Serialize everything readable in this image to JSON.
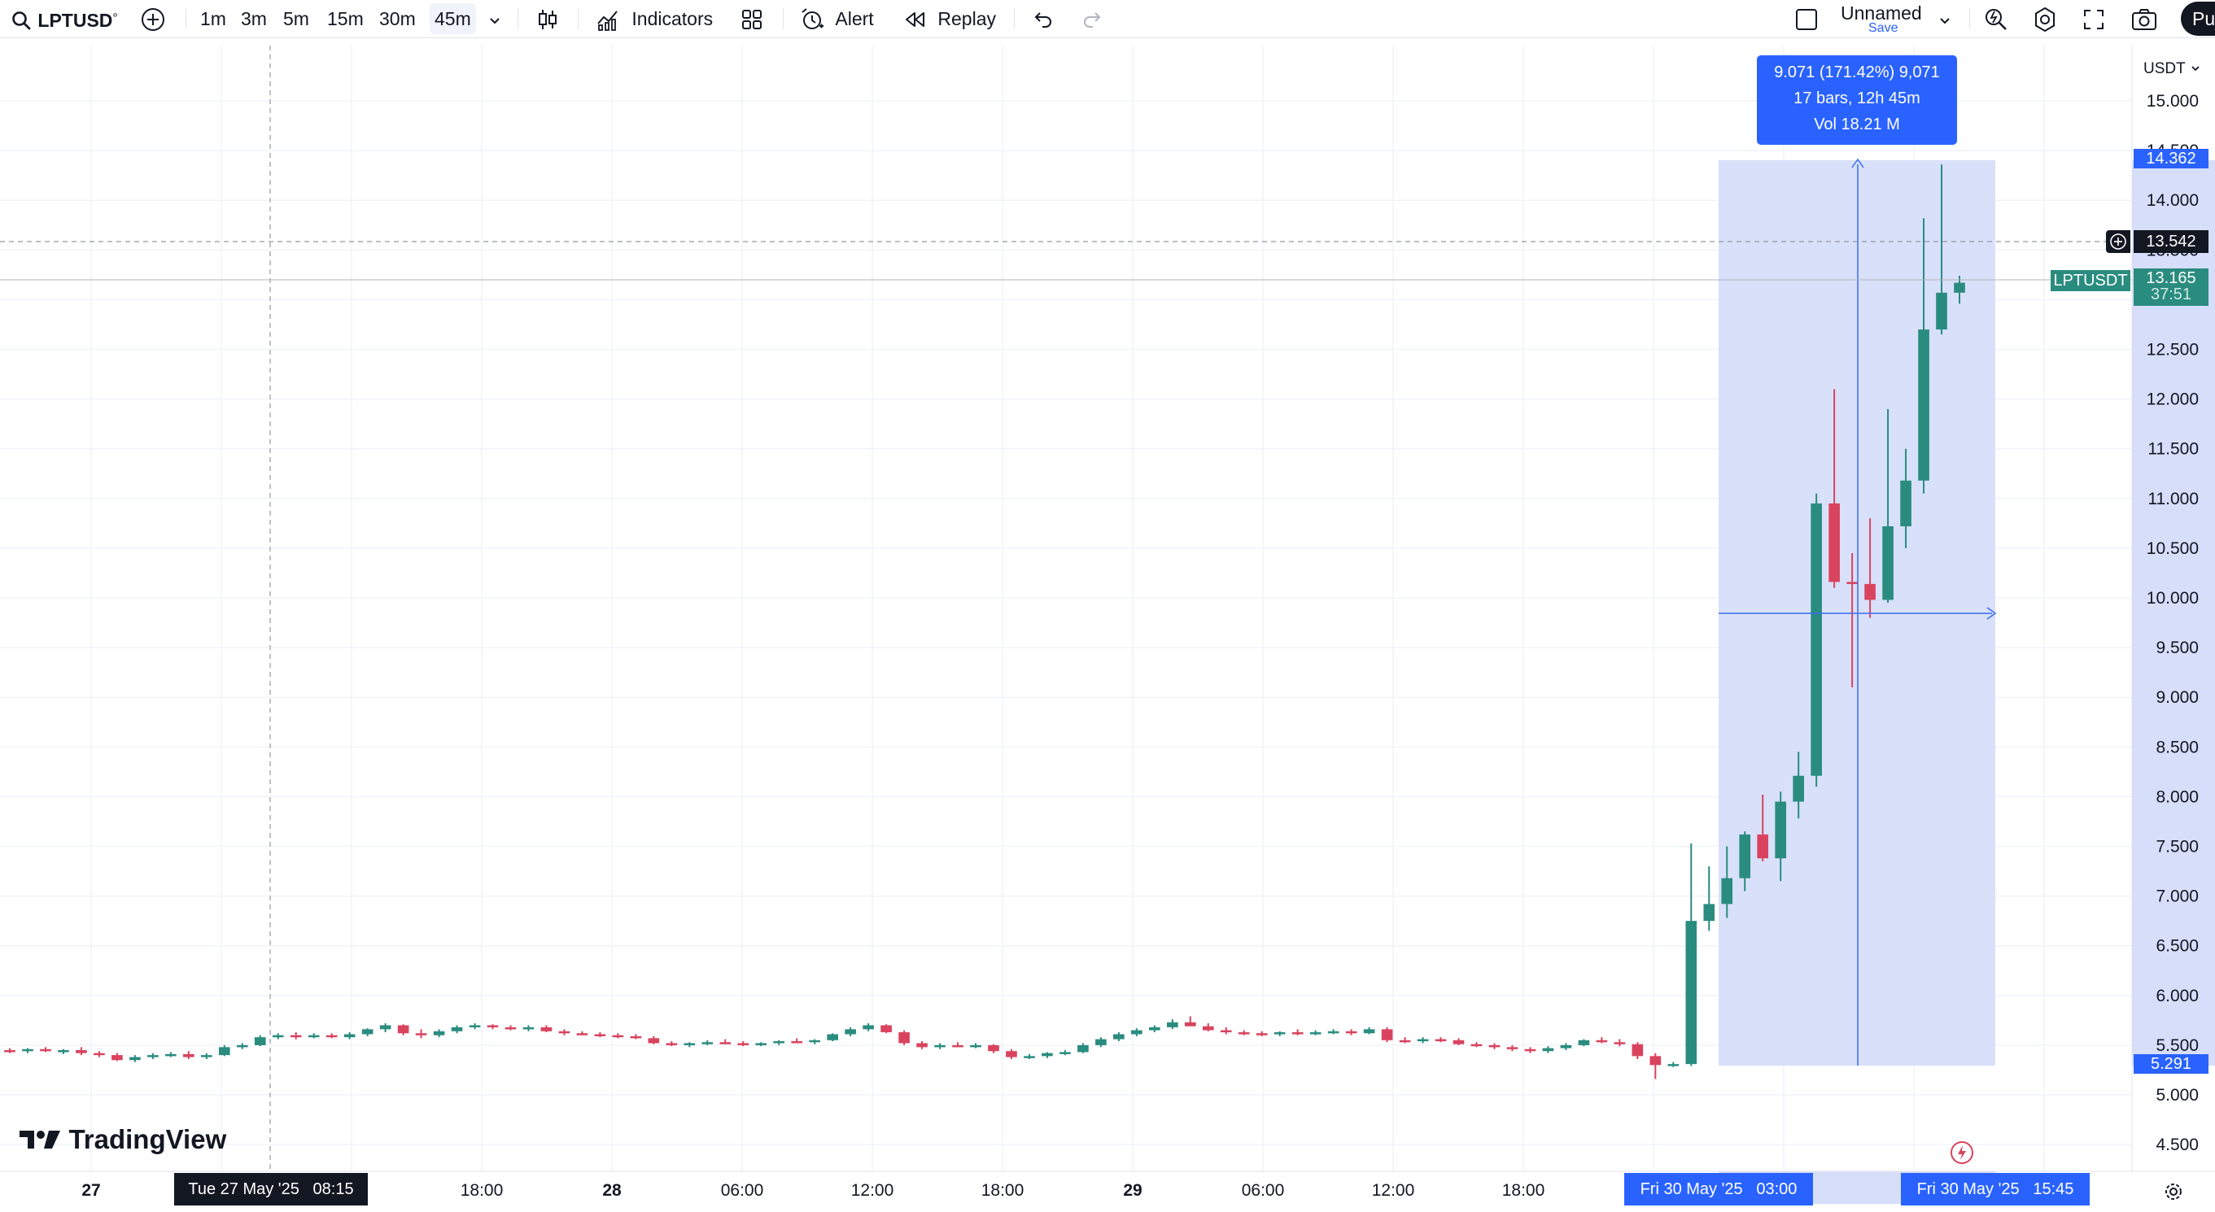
{
  "toolbar": {
    "symbol": "LPTUSD",
    "symbol_mark": "°",
    "timeframes": [
      "1m",
      "3m",
      "5m",
      "15m",
      "30m",
      "45m"
    ],
    "active_timeframe": "45m",
    "indicators_label": "Indicators",
    "alert_label": "Alert",
    "replay_label": "Replay",
    "layout_name": "Unnamed",
    "layout_save": "Save",
    "publish_label": "Pu"
  },
  "chart": {
    "currency_label": "USDT",
    "watermark": "TradingView",
    "colors": {
      "up": "#2a8c7f",
      "down": "#d9435e",
      "accent": "#2962ff",
      "range_fill": "#d6defa"
    },
    "price_ticks": [
      "15.000",
      "14.500",
      "14.000",
      "13.500",
      "13.000",
      "12.500",
      "12.000",
      "11.500",
      "11.000",
      "10.500",
      "10.000",
      "9.500",
      "9.000",
      "8.500",
      "8.000",
      "7.500",
      "7.000",
      "6.500",
      "6.000",
      "5.500",
      "5.000",
      "4.500"
    ],
    "time_ticks": [
      "27",
      "18:00",
      "28",
      "06:00",
      "12:00",
      "18:00",
      "29",
      "06:00",
      "12:00",
      "18:00"
    ],
    "measure": {
      "line1": "9.071 (171.42%) 9,071",
      "line2": "17 bars, 12h 45m",
      "line3": "Vol 18.21 M"
    },
    "price_labels": {
      "measure_high": "14.362",
      "crosshair": "13.542",
      "last": "13.165",
      "countdown": "37:51",
      "measure_low": "5.291",
      "symbol_tag": "LPTUSDT"
    },
    "time_labels": {
      "crosshair": "Tue 27 May '25   08:15",
      "range_start": "Fri 30 May '25   03:00",
      "range_end": "Fri 30 May '25   15:45"
    }
  },
  "chart_data": {
    "type": "candlestick",
    "symbol": "LPTUSD",
    "interval": "45m",
    "currency": "USDT",
    "x_ticks": [
      "27",
      "18:00",
      "28",
      "06:00",
      "12:00",
      "18:00",
      "29",
      "06:00",
      "12:00",
      "18:00"
    ],
    "ylim": [
      4.3,
      15.1
    ],
    "candles": [
      [
        5.45,
        5.47,
        5.42,
        5.44
      ],
      [
        5.44,
        5.47,
        5.42,
        5.46
      ],
      [
        5.46,
        5.48,
        5.43,
        5.44
      ],
      [
        5.44,
        5.46,
        5.41,
        5.45
      ],
      [
        5.45,
        5.48,
        5.4,
        5.42
      ],
      [
        5.42,
        5.44,
        5.38,
        5.4
      ],
      [
        5.4,
        5.42,
        5.34,
        5.35
      ],
      [
        5.35,
        5.4,
        5.33,
        5.38
      ],
      [
        5.38,
        5.42,
        5.36,
        5.4
      ],
      [
        5.4,
        5.43,
        5.38,
        5.41
      ],
      [
        5.41,
        5.44,
        5.36,
        5.38
      ],
      [
        5.38,
        5.42,
        5.36,
        5.4
      ],
      [
        5.4,
        5.5,
        5.39,
        5.48
      ],
      [
        5.48,
        5.52,
        5.46,
        5.5
      ],
      [
        5.5,
        5.6,
        5.49,
        5.58
      ],
      [
        5.58,
        5.62,
        5.56,
        5.6
      ],
      [
        5.6,
        5.63,
        5.56,
        5.59
      ],
      [
        5.59,
        5.62,
        5.57,
        5.6
      ],
      [
        5.6,
        5.62,
        5.57,
        5.58
      ],
      [
        5.58,
        5.63,
        5.56,
        5.61
      ],
      [
        5.61,
        5.67,
        5.59,
        5.66
      ],
      [
        5.66,
        5.72,
        5.63,
        5.7
      ],
      [
        5.7,
        5.71,
        5.6,
        5.62
      ],
      [
        5.62,
        5.66,
        5.57,
        5.6
      ],
      [
        5.6,
        5.66,
        5.58,
        5.64
      ],
      [
        5.64,
        5.7,
        5.62,
        5.68
      ],
      [
        5.68,
        5.72,
        5.66,
        5.7
      ],
      [
        5.7,
        5.71,
        5.66,
        5.68
      ],
      [
        5.68,
        5.7,
        5.65,
        5.67
      ],
      [
        5.67,
        5.7,
        5.64,
        5.68
      ],
      [
        5.68,
        5.7,
        5.63,
        5.64
      ],
      [
        5.64,
        5.66,
        5.6,
        5.62
      ],
      [
        5.62,
        5.64,
        5.6,
        5.61
      ],
      [
        5.61,
        5.63,
        5.58,
        5.6
      ],
      [
        5.6,
        5.62,
        5.57,
        5.59
      ],
      [
        5.59,
        5.61,
        5.56,
        5.57
      ],
      [
        5.57,
        5.59,
        5.51,
        5.52
      ],
      [
        5.52,
        5.54,
        5.49,
        5.5
      ],
      [
        5.5,
        5.53,
        5.48,
        5.52
      ],
      [
        5.52,
        5.55,
        5.5,
        5.53
      ],
      [
        5.53,
        5.56,
        5.51,
        5.52
      ],
      [
        5.52,
        5.54,
        5.49,
        5.51
      ],
      [
        5.51,
        5.53,
        5.49,
        5.52
      ],
      [
        5.52,
        5.55,
        5.5,
        5.54
      ],
      [
        5.54,
        5.57,
        5.52,
        5.53
      ],
      [
        5.53,
        5.56,
        5.51,
        5.55
      ],
      [
        5.55,
        5.62,
        5.54,
        5.61
      ],
      [
        5.61,
        5.68,
        5.59,
        5.66
      ],
      [
        5.66,
        5.72,
        5.64,
        5.7
      ],
      [
        5.7,
        5.71,
        5.62,
        5.63
      ],
      [
        5.63,
        5.65,
        5.5,
        5.52
      ],
      [
        5.52,
        5.54,
        5.46,
        5.48
      ],
      [
        5.48,
        5.52,
        5.46,
        5.5
      ],
      [
        5.5,
        5.53,
        5.48,
        5.49
      ],
      [
        5.49,
        5.52,
        5.47,
        5.5
      ],
      [
        5.5,
        5.51,
        5.42,
        5.44
      ],
      [
        5.44,
        5.46,
        5.36,
        5.38
      ],
      [
        5.38,
        5.41,
        5.36,
        5.39
      ],
      [
        5.39,
        5.43,
        5.37,
        5.42
      ],
      [
        5.42,
        5.45,
        5.4,
        5.43
      ],
      [
        5.43,
        5.52,
        5.42,
        5.5
      ],
      [
        5.5,
        5.58,
        5.48,
        5.56
      ],
      [
        5.56,
        5.63,
        5.54,
        5.61
      ],
      [
        5.61,
        5.67,
        5.59,
        5.65
      ],
      [
        5.65,
        5.7,
        5.63,
        5.68
      ],
      [
        5.68,
        5.76,
        5.66,
        5.73
      ],
      [
        5.73,
        5.79,
        5.7,
        5.69
      ],
      [
        5.69,
        5.72,
        5.64,
        5.65
      ],
      [
        5.65,
        5.68,
        5.61,
        5.63
      ],
      [
        5.63,
        5.65,
        5.6,
        5.62
      ],
      [
        5.62,
        5.64,
        5.59,
        5.61
      ],
      [
        5.61,
        5.64,
        5.59,
        5.63
      ],
      [
        5.63,
        5.66,
        5.6,
        5.62
      ],
      [
        5.62,
        5.65,
        5.6,
        5.63
      ],
      [
        5.63,
        5.66,
        5.61,
        5.64
      ],
      [
        5.64,
        5.66,
        5.6,
        5.62
      ],
      [
        5.62,
        5.68,
        5.61,
        5.66
      ],
      [
        5.66,
        5.68,
        5.53,
        5.55
      ],
      [
        5.55,
        5.58,
        5.52,
        5.54
      ],
      [
        5.54,
        5.58,
        5.52,
        5.56
      ],
      [
        5.56,
        5.58,
        5.53,
        5.55
      ],
      [
        5.55,
        5.57,
        5.5,
        5.51
      ],
      [
        5.51,
        5.53,
        5.48,
        5.5
      ],
      [
        5.5,
        5.52,
        5.46,
        5.48
      ],
      [
        5.48,
        5.5,
        5.44,
        5.46
      ],
      [
        5.46,
        5.48,
        5.42,
        5.44
      ],
      [
        5.44,
        5.49,
        5.42,
        5.47
      ],
      [
        5.47,
        5.52,
        5.45,
        5.5
      ],
      [
        5.5,
        5.56,
        5.49,
        5.55
      ],
      [
        5.55,
        5.58,
        5.52,
        5.53
      ],
      [
        5.53,
        5.56,
        5.49,
        5.51
      ],
      [
        5.51,
        5.53,
        5.36,
        5.39
      ],
      [
        5.39,
        5.42,
        5.16,
        5.3
      ],
      [
        5.3,
        5.33,
        5.28,
        5.31
      ],
      [
        5.31,
        7.53,
        5.29,
        6.75
      ],
      [
        6.75,
        7.3,
        6.65,
        6.92
      ],
      [
        6.92,
        7.5,
        6.78,
        7.18
      ],
      [
        7.18,
        7.65,
        7.05,
        7.62
      ],
      [
        7.62,
        8.02,
        7.35,
        7.38
      ],
      [
        7.38,
        8.05,
        7.15,
        7.95
      ],
      [
        7.95,
        8.45,
        7.78,
        8.21
      ],
      [
        8.21,
        11.05,
        8.1,
        10.95
      ],
      [
        10.95,
        12.1,
        10.1,
        10.16
      ],
      [
        10.16,
        10.45,
        9.1,
        10.14
      ],
      [
        10.14,
        10.8,
        9.8,
        9.98
      ],
      [
        9.98,
        11.9,
        9.95,
        10.72
      ],
      [
        10.72,
        11.5,
        10.5,
        11.18
      ],
      [
        11.18,
        13.82,
        11.05,
        12.7
      ],
      [
        12.7,
        14.36,
        12.65,
        13.07
      ],
      [
        13.07,
        13.24,
        12.96,
        13.17
      ]
    ]
  }
}
